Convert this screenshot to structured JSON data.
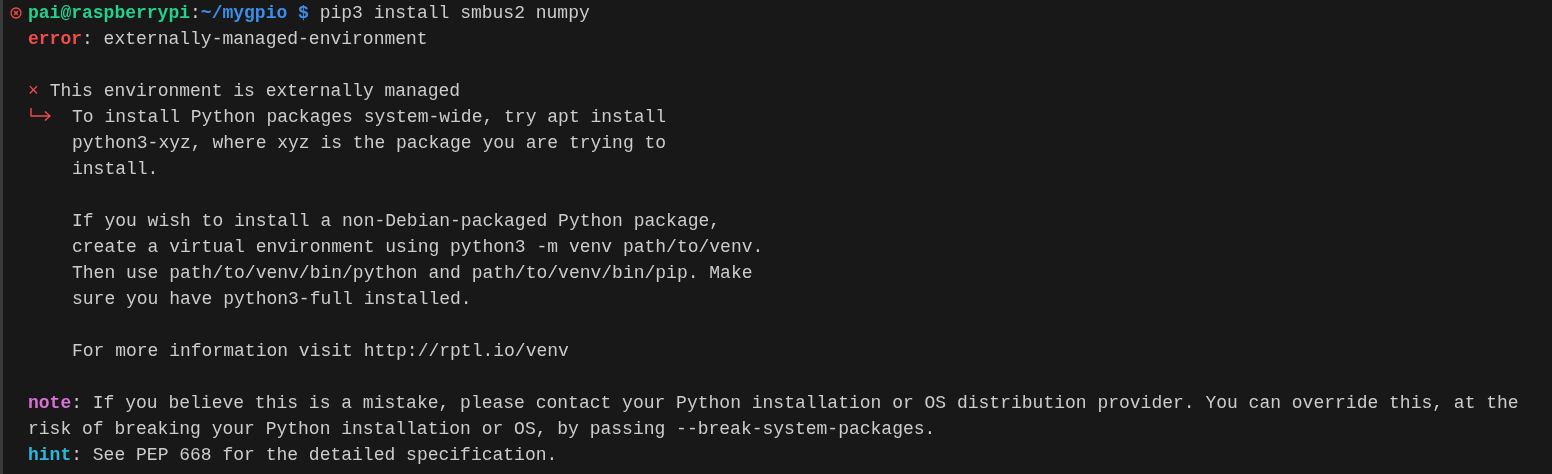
{
  "prompt": {
    "user_host": "pai@raspberrypi",
    "separator": ":",
    "path": "~/mygpio",
    "symbol": "$",
    "command": "pip3 install smbus2 numpy",
    "failed": true
  },
  "error": {
    "label": "error",
    "text": ": externally-managed-environment"
  },
  "cause": {
    "marker": "×",
    "title": "This environment is externally managed",
    "paragraphs": [
      [
        "To install Python packages system-wide, try apt install",
        "python3-xyz, where xyz is the package you are trying to",
        "install."
      ],
      [
        "If you wish to install a non-Debian-packaged Python package,",
        "create a virtual environment using python3 -m venv path/to/venv.",
        "Then use path/to/venv/bin/python and path/to/venv/bin/pip. Make",
        "sure you have python3-full installed."
      ],
      [
        "For more information visit http://rptl.io/venv"
      ]
    ]
  },
  "messages": [
    {
      "kind": "note",
      "label": "note",
      "lines": [
        ": If you believe this is a mistake, please contact your Python installation or OS distribution provider. You can override this, at the",
        "risk of breaking your Python installation or OS, by passing --break-system-packages."
      ]
    },
    {
      "kind": "hint",
      "label": "hint",
      "lines": [
        ": See PEP 668 for the detailed specification."
      ]
    }
  ]
}
